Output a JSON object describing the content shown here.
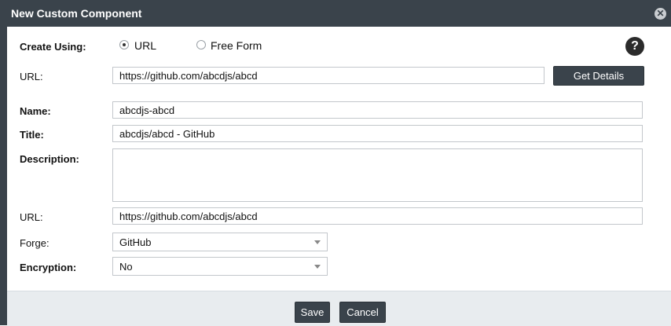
{
  "dialog": {
    "title": "New Custom Component",
    "close_icon": "close-circle-icon"
  },
  "create_using": {
    "label": "Create Using:",
    "options": [
      {
        "label": "URL",
        "selected": true
      },
      {
        "label": "Free Form",
        "selected": false
      }
    ]
  },
  "help_label": "?",
  "url_source": {
    "label": "URL:",
    "value": "https://github.com/abcdjs/abcd",
    "button_label": "Get Details"
  },
  "form": {
    "name_label": "Name:",
    "name_value": "abcdjs-abcd",
    "title_label": "Title:",
    "title_value": "abcdjs/abcd - GitHub",
    "description_label": "Description:",
    "description_value": "",
    "url_label": "URL:",
    "url_value": "https://github.com/abcdjs/abcd",
    "forge_label": "Forge:",
    "forge_value": "GitHub",
    "encryption_label": "Encryption:",
    "encryption_value": "No"
  },
  "footer": {
    "save_label": "Save",
    "cancel_label": "Cancel"
  }
}
